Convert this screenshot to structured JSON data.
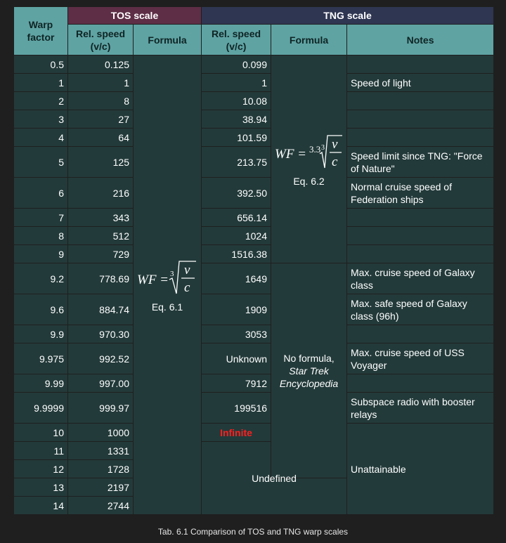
{
  "headers": {
    "warp_factor": "Warp factor",
    "tos_scale": "TOS scale",
    "tng_scale": "TNG scale",
    "tos_rel_speed": "Rel. speed (v/c)",
    "tos_formula": "Formula",
    "tng_rel_speed": "Rel. speed (v/c)",
    "tng_formula": "Formula",
    "notes": "Notes"
  },
  "tos_formula": {
    "prefix": "WF =",
    "index": "3",
    "num": "v",
    "den": "c",
    "label": "Eq. 6.1"
  },
  "tng_formula": {
    "prefix": "WF =",
    "coef": "3.3",
    "index": "3",
    "num": "v",
    "den": "c",
    "label": "Eq. 6.2"
  },
  "no_formula": {
    "line1": "No formula,",
    "line2": "Star Trek",
    "line3": "Encyclopedia"
  },
  "rows": [
    {
      "warp": "0.5",
      "tos": "0.125",
      "tng": "0.099",
      "note": ""
    },
    {
      "warp": "1",
      "tos": "1",
      "tng": "1",
      "note": "Speed of light"
    },
    {
      "warp": "2",
      "tos": "8",
      "tng": "10.08",
      "note": ""
    },
    {
      "warp": "3",
      "tos": "27",
      "tng": "38.94",
      "note": ""
    },
    {
      "warp": "4",
      "tos": "64",
      "tng": "101.59",
      "note": ""
    },
    {
      "warp": "5",
      "tos": "125",
      "tng": "213.75",
      "note": "Speed limit since TNG: \"Force of Nature\""
    },
    {
      "warp": "6",
      "tos": "216",
      "tng": "392.50",
      "note": "Normal cruise speed of Federation ships"
    },
    {
      "warp": "7",
      "tos": "343",
      "tng": "656.14",
      "note": ""
    },
    {
      "warp": "8",
      "tos": "512",
      "tng": "1024",
      "note": ""
    },
    {
      "warp": "9",
      "tos": "729",
      "tng": "1516.38",
      "note": ""
    },
    {
      "warp": "9.2",
      "tos": "778.69",
      "tng": "1649",
      "note": "Max. cruise speed of Galaxy class"
    },
    {
      "warp": "9.6",
      "tos": "884.74",
      "tng": "1909",
      "note": "Max. safe speed of Galaxy class (96h)"
    },
    {
      "warp": "9.9",
      "tos": "970.30",
      "tng": "3053",
      "note": ""
    },
    {
      "warp": "9.975",
      "tos": "992.52",
      "tng": "Unknown",
      "note": "Max. cruise speed of USS Voyager"
    },
    {
      "warp": "9.99",
      "tos": "997.00",
      "tng": "7912",
      "note": ""
    },
    {
      "warp": "9.9999",
      "tos": "999.97",
      "tng": "199516",
      "note": "Subspace radio with booster relays"
    },
    {
      "warp": "10",
      "tos": "1000",
      "tng": "Infinite",
      "note": ""
    },
    {
      "warp": "11",
      "tos": "1331",
      "tng": "",
      "note": ""
    },
    {
      "warp": "12",
      "tos": "1728",
      "tng": "",
      "note": ""
    },
    {
      "warp": "13",
      "tos": "2197",
      "tng": "",
      "note": ""
    },
    {
      "warp": "14",
      "tos": "2744",
      "tng": "",
      "note": ""
    }
  ],
  "undefined_label": "Undefined",
  "unattainable_label": "Unattainable",
  "caption": "Tab. 6.1 Comparison of TOS and TNG warp scales",
  "colors": {
    "background": "#1f1f1f",
    "tos_header": "#5e2e46",
    "tng_header": "#2f3652",
    "column_header": "#5fa3a3",
    "cell": "#233a3a",
    "infinite": "#ff1f1f"
  }
}
